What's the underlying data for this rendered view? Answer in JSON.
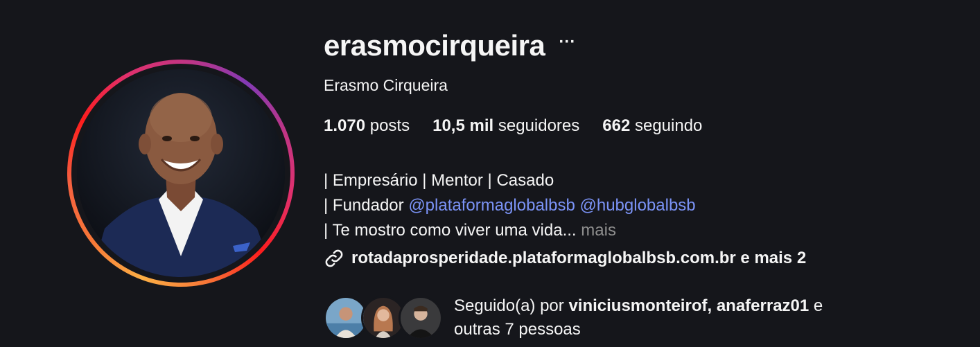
{
  "profile": {
    "username": "erasmocirqueira",
    "more_icon": "···",
    "full_name": "Erasmo Cirqueira"
  },
  "stats": {
    "posts_count": "1.070",
    "posts_label": "posts",
    "followers_count": "10,5 mil",
    "followers_label": "seguidores",
    "following_count": "662",
    "following_label": "seguindo"
  },
  "bio": {
    "line1": "| Empresário | Mentor | Casado",
    "line2_prefix": "| Fundador ",
    "mention1": "@plataformaglobalbsb",
    "mention2": "@hubglobalbsb",
    "line3": "| Te mostro como viver uma vida...",
    "more_label": "mais"
  },
  "link": {
    "icon": "link-icon",
    "url_text": "rotadaprosperidade.plataformaglobalbsb.com.br e mais 2"
  },
  "followed_by": {
    "prefix": "Seguido(a) por ",
    "user1": "viniciusmonteirof",
    "separator": ", ",
    "user2": "anaferraz01",
    "suffix": " e",
    "line2": "outras 7 pessoas"
  },
  "colors": {
    "background": "#15161b",
    "mention": "#7b93f6",
    "muted": "#8e8e8e"
  }
}
